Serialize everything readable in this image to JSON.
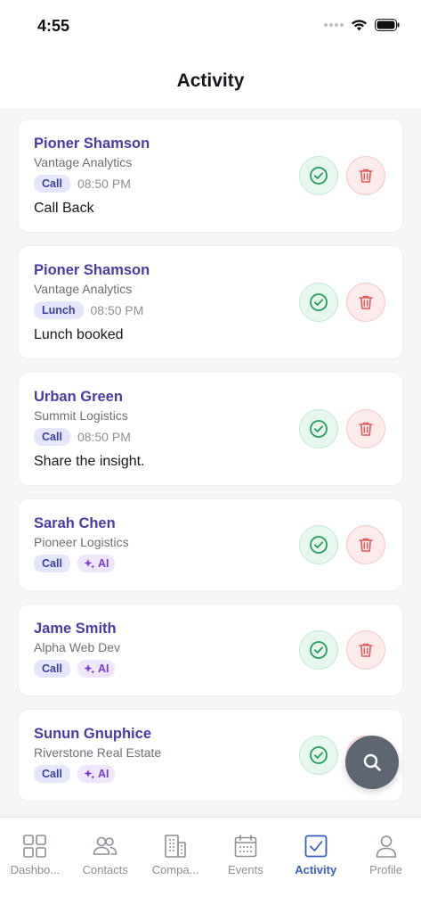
{
  "status_bar": {
    "time": "4:55"
  },
  "header": {
    "title": "Activity"
  },
  "activities": [
    {
      "name": "Pioner Shamson",
      "company": "Vantage Analytics",
      "type": "Call",
      "time": "08:50 PM",
      "note": "Call Back"
    },
    {
      "name": "Pioner Shamson",
      "company": "Vantage Analytics",
      "type": "Lunch",
      "time": "08:50 PM",
      "note": "Lunch booked"
    },
    {
      "name": "Urban Green",
      "company": "Summit Logistics",
      "type": "Call",
      "time": "08:50 PM",
      "note": "Share the insight."
    },
    {
      "name": "Sarah Chen",
      "company": "Pioneer Logistics",
      "type": "Call",
      "ai": "AI"
    },
    {
      "name": "Jame Smith",
      "company": "Alpha Web Dev",
      "type": "Call",
      "ai": "AI"
    },
    {
      "name": "Sunun Gnuphice",
      "company": "Riverstone Real Estate",
      "type": "Call",
      "ai": "AI"
    }
  ],
  "tabs": [
    {
      "label": "Dashbo...",
      "icon": "dashboard-icon"
    },
    {
      "label": "Contacts",
      "icon": "contacts-icon"
    },
    {
      "label": "Compa...",
      "icon": "companies-icon"
    },
    {
      "label": "Events",
      "icon": "events-icon"
    },
    {
      "label": "Activity",
      "icon": "activity-icon",
      "active": true
    },
    {
      "label": "Profile",
      "icon": "profile-icon"
    }
  ],
  "colors": {
    "accent": "#3b5bc4",
    "name": "#4b3aa8",
    "done": "#1f9d5c",
    "delete": "#e05c5c",
    "fab": "#5f6673"
  }
}
